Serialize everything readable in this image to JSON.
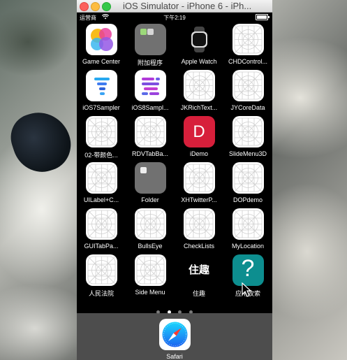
{
  "window": {
    "title": "iOS Simulator - iPhone 6 - iPh..."
  },
  "statusbar": {
    "carrier": "运营商",
    "time": "下午2:19"
  },
  "apps": [
    {
      "label": "Game Center"
    },
    {
      "label": "附加程序"
    },
    {
      "label": "Apple Watch"
    },
    {
      "label": "CHDControl..."
    },
    {
      "label": "iOS7Sampler"
    },
    {
      "label": "iOS8Sampl..."
    },
    {
      "label": "JKRichText..."
    },
    {
      "label": "JYCoreData"
    },
    {
      "label": "02-带颜色..."
    },
    {
      "label": "RDVTabBa..."
    },
    {
      "label": "iDemo",
      "icon_text": "D"
    },
    {
      "label": "SlideMenu3D"
    },
    {
      "label": "UILabel+C..."
    },
    {
      "label": "Folder"
    },
    {
      "label": "XHTwitterP..."
    },
    {
      "label": "DOPdemo"
    },
    {
      "label": "GUITabPa..."
    },
    {
      "label": "BullsEye"
    },
    {
      "label": "CheckLists"
    },
    {
      "label": "MyLocation"
    },
    {
      "label": "人民法院"
    },
    {
      "label": "Side Menu"
    },
    {
      "label": "住趣",
      "icon_text": "住趣"
    },
    {
      "label": "应用攻索",
      "icon_text": "?"
    }
  ],
  "dock": {
    "label": "Safari"
  },
  "colors": {
    "idemo": "#d71f3b",
    "help": "#0d8e8f",
    "dock": "#5a5a5a"
  }
}
